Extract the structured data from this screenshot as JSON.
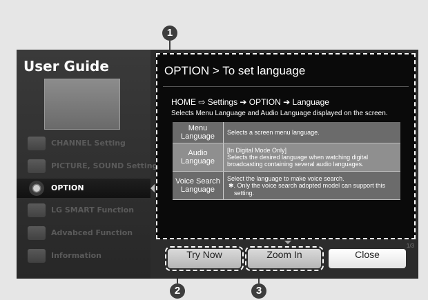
{
  "callouts": [
    "1",
    "2",
    "3"
  ],
  "sidebar": {
    "title": "User Guide",
    "items": [
      {
        "label": "CHANNEL Setting",
        "icon": "channel-icon"
      },
      {
        "label": "PICTURE, SOUND Setting",
        "icon": "picture-sound-icon"
      },
      {
        "label": "OPTION",
        "icon": "option-icon"
      },
      {
        "label": "LG SMART Function",
        "icon": "lg-smart-icon"
      },
      {
        "label": "Advabced Function",
        "icon": "advanced-icon"
      },
      {
        "label": "Information",
        "icon": "information-icon"
      }
    ],
    "active_index": 2
  },
  "content": {
    "title": "OPTION > To set language",
    "path": "HOME ⇨ Settings ➔ OPTION ➔ Language",
    "description": "Selects Menu Language and Audio Language displayed on the screen.",
    "rows": [
      {
        "key": "Menu Language",
        "lines": [
          "Selects a screen menu language."
        ]
      },
      {
        "key": "Audio Language",
        "lines": [
          "[In Digital Mode Only]",
          "Selects the desired language when watching digital broadcasting containing several audio languages."
        ]
      },
      {
        "key": "Voice Search Language",
        "lines": [
          "Select the language to make voice search.",
          "✱. Only the voice search adopted model can support this setting."
        ]
      }
    ],
    "page": "1/3"
  },
  "buttons": {
    "try_now": "Try Now",
    "zoom_in": "Zoom In",
    "close": "Close"
  },
  "colors": {
    "background": "#e6e6e6",
    "panel": "#2c2c2c",
    "content_bg": "#0a0a0a",
    "table_row": "#6b6b6b",
    "table_row_alt": "#8f8f8f"
  }
}
